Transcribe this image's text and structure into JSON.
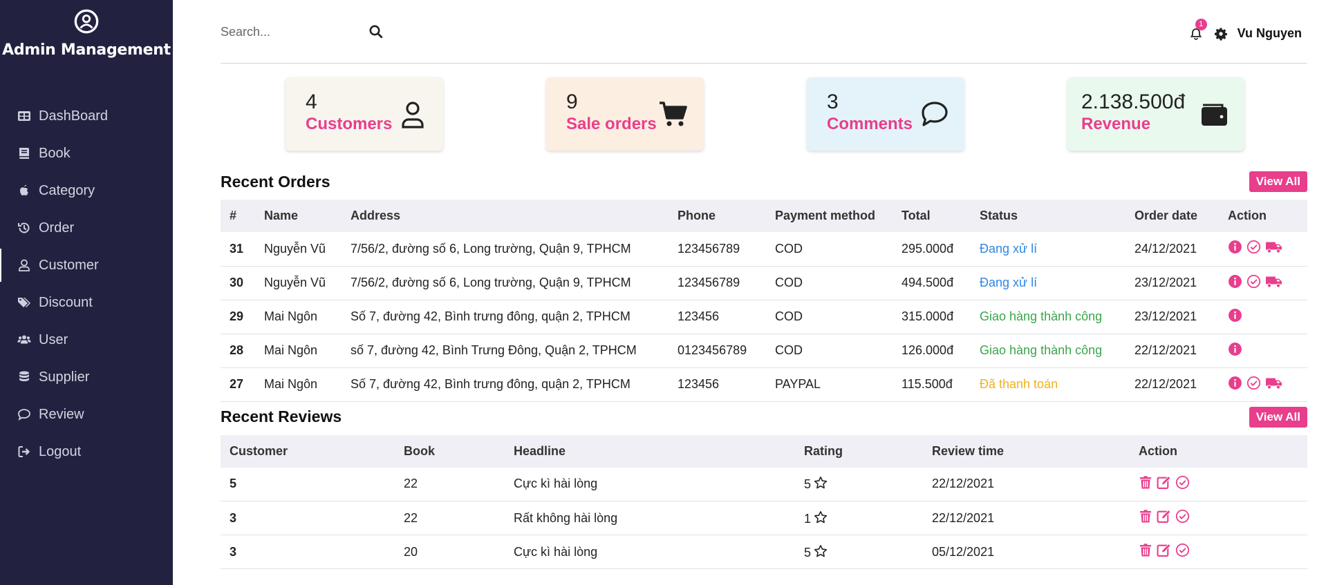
{
  "app": {
    "title": "Admin Management"
  },
  "sidebar": {
    "items": [
      {
        "label": "DashBoard",
        "icon": "table-icon"
      },
      {
        "label": "Book",
        "icon": "book-icon"
      },
      {
        "label": "Category",
        "icon": "apple-icon"
      },
      {
        "label": "Order",
        "icon": "history-icon"
      },
      {
        "label": "Customer",
        "icon": "user-icon"
      },
      {
        "label": "Discount",
        "icon": "tags-icon"
      },
      {
        "label": "User",
        "icon": "users-icon"
      },
      {
        "label": "Supplier",
        "icon": "database-icon"
      },
      {
        "label": "Review",
        "icon": "comment-icon"
      },
      {
        "label": "Logout",
        "icon": "logout-icon"
      }
    ],
    "active": "Customer"
  },
  "search": {
    "placeholder": "Search..."
  },
  "header": {
    "notifications": "1",
    "user": "Vu Nguyen"
  },
  "cards": [
    {
      "value": "4",
      "label": "Customers",
      "icon": "user-icon",
      "bg": "#f8f5ee"
    },
    {
      "value": "9",
      "label": "Sale orders",
      "icon": "cart-icon",
      "bg": "#fdeee2"
    },
    {
      "value": "3",
      "label": "Comments",
      "icon": "comment-icon",
      "bg": "#e4f3f9"
    },
    {
      "value": "2.138.500đ",
      "label": "Revenue",
      "icon": "wallet-icon",
      "bg": "#eaf9ee"
    }
  ],
  "orders": {
    "title": "Recent Orders",
    "view_all": "View All",
    "columns": [
      "#",
      "Name",
      "Address",
      "Phone",
      "Payment method",
      "Total",
      "Status",
      "Order date",
      "Action"
    ],
    "rows": [
      {
        "id": "31",
        "name": "Nguyễn Vũ",
        "address": "7/56/2, đường số 6, Long trường, Quận 9, TPHCM",
        "phone": "123456789",
        "payment": "COD",
        "total": "295.000đ",
        "status": "Đang xử lí",
        "status_color": "#2f86e4",
        "date": "24/12/2021"
      },
      {
        "id": "30",
        "name": "Nguyễn Vũ",
        "address": "7/56/2, đường số 6, Long trường, Quận 9, TPHCM",
        "phone": "123456789",
        "payment": "COD",
        "total": "494.500đ",
        "status": "Đang xử lí",
        "status_color": "#2f86e4",
        "date": "23/12/2021"
      },
      {
        "id": "29",
        "name": "Mai Ngôn",
        "address": "Số 7, đường 42, Bình trưng đông, quận 2, TPHCM",
        "phone": "123456",
        "payment": "COD",
        "total": "315.000đ",
        "status": "Giao hàng thành công",
        "status_color": "#3aa54a",
        "date": "23/12/2021"
      },
      {
        "id": "28",
        "name": "Mai Ngôn",
        "address": "số 7, đường 42, Bình Trưng Đông, Quận 2, TPHCM",
        "phone": "0123456789",
        "payment": "COD",
        "total": "126.000đ",
        "status": "Giao hàng thành công",
        "status_color": "#3aa54a",
        "date": "22/12/2021"
      },
      {
        "id": "27",
        "name": "Mai Ngôn",
        "address": "Số 7, đường 42, Bình trưng đông, quận 2, TPHCM",
        "phone": "123456",
        "payment": "PAYPAL",
        "total": "115.500đ",
        "status": "Đã thanh toán",
        "status_color": "#f3b01f",
        "date": "22/12/2021"
      }
    ]
  },
  "reviews": {
    "title": "Recent Reviews",
    "view_all": "View All",
    "columns": [
      "Customer",
      "Book",
      "Headline",
      "Rating",
      "Review time",
      "Action"
    ],
    "rows": [
      {
        "customer": "5",
        "book": "22",
        "headline": "Cực kì hài lòng",
        "rating": "5",
        "time": "22/12/2021"
      },
      {
        "customer": "3",
        "book": "22",
        "headline": "Rất không hài lòng",
        "rating": "1",
        "time": "22/12/2021"
      },
      {
        "customer": "3",
        "book": "20",
        "headline": "Cực kì hài lòng",
        "rating": "5",
        "time": "05/12/2021"
      }
    ]
  },
  "colors": {
    "sidebar": "#222240",
    "accent": "#e83e8c"
  }
}
